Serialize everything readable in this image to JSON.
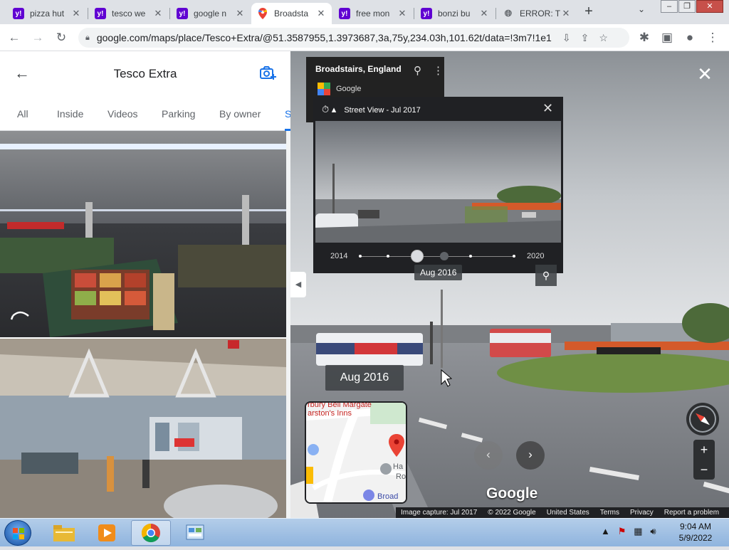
{
  "browser": {
    "tabs": [
      {
        "title": "pizza hut",
        "favicon": "yahoo-icon",
        "active": false
      },
      {
        "title": "tesco we",
        "favicon": "yahoo-icon",
        "active": false
      },
      {
        "title": "google n",
        "favicon": "yahoo-icon",
        "active": false
      },
      {
        "title": "Broadsta",
        "favicon": "google-maps-icon",
        "active": true
      },
      {
        "title": "free mon",
        "favicon": "yahoo-icon",
        "active": false
      },
      {
        "title": "bonzi bu",
        "favicon": "yahoo-icon",
        "active": false
      },
      {
        "title": "ERROR: T",
        "favicon": "globe-icon",
        "active": false
      }
    ],
    "url": "google.com/maps/place/Tesco+Extra/@51.3587955,1.3973687,3a,75y,234.03h,101.62t/data=!3m7!1e1..."
  },
  "left_panel": {
    "title": "Tesco Extra",
    "filters": [
      "All",
      "Inside",
      "Videos",
      "Parking",
      "By owner",
      "S"
    ]
  },
  "street_view": {
    "place": "Broadstairs, England",
    "provider": "Google",
    "time_machine": {
      "header": "Street View - Jul 2017",
      "selected_date": "Aug 2016",
      "year_start": "2014",
      "year_end": "2020"
    },
    "date_badge": "Aug 2016",
    "minimap_labels": [
      "rbury Bell Margate",
      "arston's Inns",
      "Ha",
      "Ro",
      "Broad"
    ],
    "logo": "Google",
    "footer": [
      "Image capture: Jul 2017",
      "© 2022 Google",
      "United States",
      "Terms",
      "Privacy",
      "Report a problem"
    ]
  },
  "taskbar": {
    "time": "9:04 AM",
    "date": "5/9/2022"
  },
  "colors": {
    "yahoo": "#6001d2",
    "maps_red": "#ea4335",
    "sv_panel": "#202124"
  }
}
